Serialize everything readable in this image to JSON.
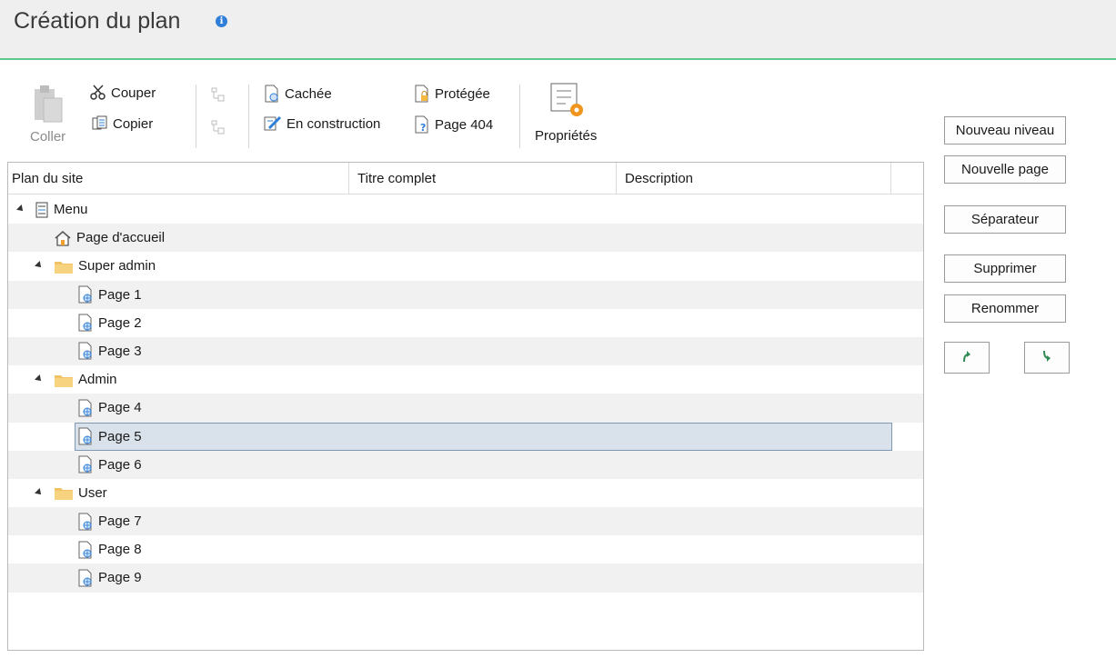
{
  "header": {
    "title": "Création du plan"
  },
  "toolbar": {
    "paste_label": "Coller",
    "cut_label": "Couper",
    "copy_label": "Copier",
    "hidden_label": "Cachée",
    "under_construction_label": "En construction",
    "protected_label": "Protégée",
    "page404_label": "Page 404",
    "properties_label": "Propriétés"
  },
  "grid": {
    "columns": [
      "Plan du site",
      "Titre complet",
      "Description"
    ],
    "rows": [
      {
        "label": "Menu",
        "type": "menu",
        "level": 0,
        "expanded": true
      },
      {
        "label": "Page d'accueil",
        "type": "home",
        "level": 1
      },
      {
        "label": "Super admin",
        "type": "folder",
        "level": 1,
        "expanded": true
      },
      {
        "label": "Page 1",
        "type": "page",
        "level": 2
      },
      {
        "label": "Page 2",
        "type": "page",
        "level": 2
      },
      {
        "label": "Page 3",
        "type": "page",
        "level": 2
      },
      {
        "label": "Admin",
        "type": "folder",
        "level": 1,
        "expanded": true
      },
      {
        "label": "Page 4",
        "type": "page",
        "level": 2
      },
      {
        "label": "Page 5",
        "type": "page",
        "level": 2,
        "selected": true
      },
      {
        "label": "Page 6",
        "type": "page",
        "level": 2
      },
      {
        "label": "User",
        "type": "folder",
        "level": 1,
        "expanded": true
      },
      {
        "label": "Page 7",
        "type": "page",
        "level": 2
      },
      {
        "label": "Page 8",
        "type": "page",
        "level": 2
      },
      {
        "label": "Page 9",
        "type": "page",
        "level": 2
      }
    ]
  },
  "sidebar": {
    "new_level_label": "Nouveau niveau",
    "new_page_label": "Nouvelle page",
    "separator_label": "Séparateur",
    "delete_label": "Supprimer",
    "rename_label": "Renommer"
  },
  "colors": {
    "accent": "#5cc98a",
    "selected_bg": "#d9e1ea",
    "selected_border": "#7f99b5",
    "folder": "#f5c76a"
  }
}
